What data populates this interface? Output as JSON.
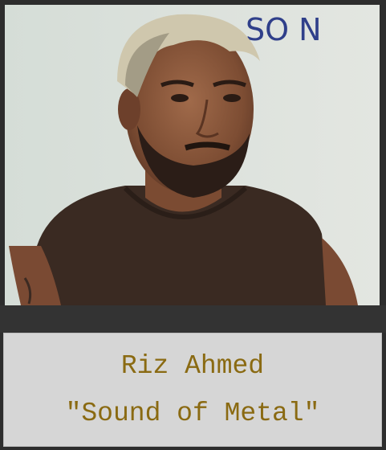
{
  "card": {
    "name": "Riz Ahmed",
    "film": "\"Sound of Metal\""
  },
  "photo": {
    "subject_icon": "portrait-photo",
    "board_text": "SO N"
  },
  "colors": {
    "caption_text": "#8a6a12",
    "caption_bg": "#d6d6d6",
    "frame": "#2d2d2d"
  }
}
